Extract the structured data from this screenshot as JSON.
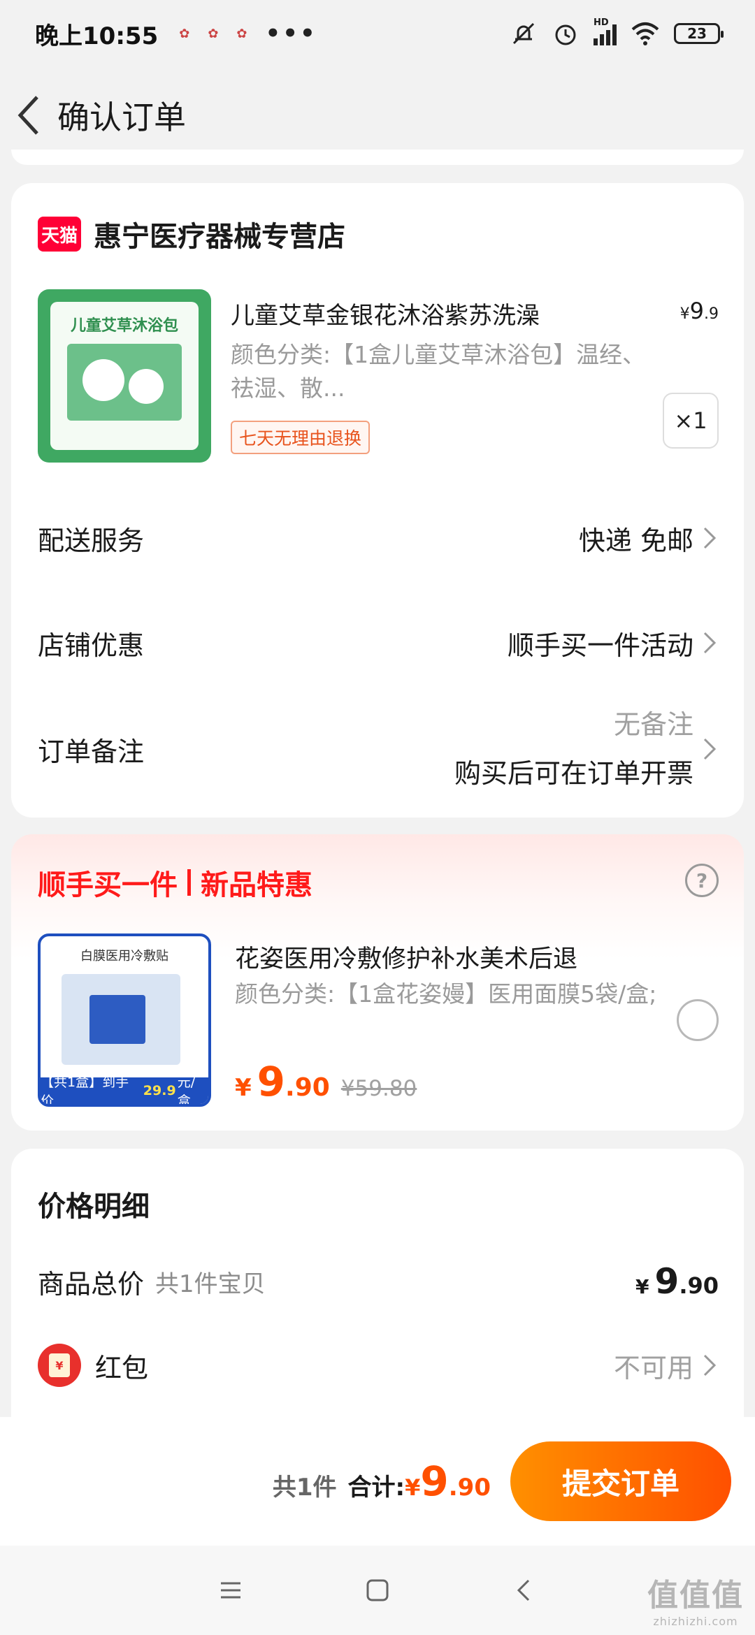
{
  "status_bar": {
    "time": "晚上10:55",
    "notif_icons": [
      "app-icon",
      "app-icon",
      "app-icon"
    ],
    "more": "•••",
    "network": "HD",
    "battery": "23"
  },
  "header": {
    "title": "确认订单"
  },
  "store": {
    "badge": "天猫",
    "name": "惠宁医疗器械专营店",
    "product": {
      "image_title": "儿童艾草沐浴包",
      "title": "儿童艾草金银花沐浴紫苏洗澡",
      "price_symbol": "¥",
      "price_int": "9",
      "price_dec": ".9",
      "spec": "颜色分类:【1盒儿童艾草沐浴包】温经、祛湿、散...",
      "tag": "七天无理由退换",
      "quantity": "×1"
    },
    "delivery": {
      "label": "配送服务",
      "value": "快递 免邮"
    },
    "coupon": {
      "label": "店铺优惠",
      "value": "顺手买一件活动"
    },
    "note": {
      "label": "订单备注",
      "value": "无备注",
      "invoice": "购买后可在订单开票"
    }
  },
  "deal": {
    "title_left": "顺手买一件",
    "title_right": "新品特惠",
    "help": "?",
    "product": {
      "image_top": "白膜医用冷敷贴",
      "image_bar_pre": "【共1盒】到手价",
      "image_bar_price": "29.9",
      "image_bar_post": "元/盒",
      "name": "花姿医用冷敷修护补水美术后退",
      "spec": "颜色分类:【1盒花姿嫚】医用面膜5袋/盒;",
      "price_symbol": "¥",
      "price_int": "9",
      "price_dec": ".90",
      "orig_price": "¥59.80",
      "selected": false
    }
  },
  "price_detail": {
    "title": "价格明细",
    "total": {
      "label": "商品总价",
      "sub": "共1件宝贝",
      "symbol": "¥",
      "int": "9",
      "dec": ".90"
    },
    "redpack": {
      "label": "红包",
      "icon_char": "¥",
      "value": "不可用"
    }
  },
  "bottom_bar": {
    "count": "共1件",
    "sum_label": "合计:",
    "symbol": "¥",
    "int": "9",
    "dec": ".90",
    "submit": "提交订单"
  },
  "watermark": {
    "line1": "值值值",
    "line2": "zhizhizhi.com"
  },
  "colors": {
    "accent": "#ff5000",
    "deal_red": "#ff1a1a",
    "tmall": "#ff0036"
  }
}
